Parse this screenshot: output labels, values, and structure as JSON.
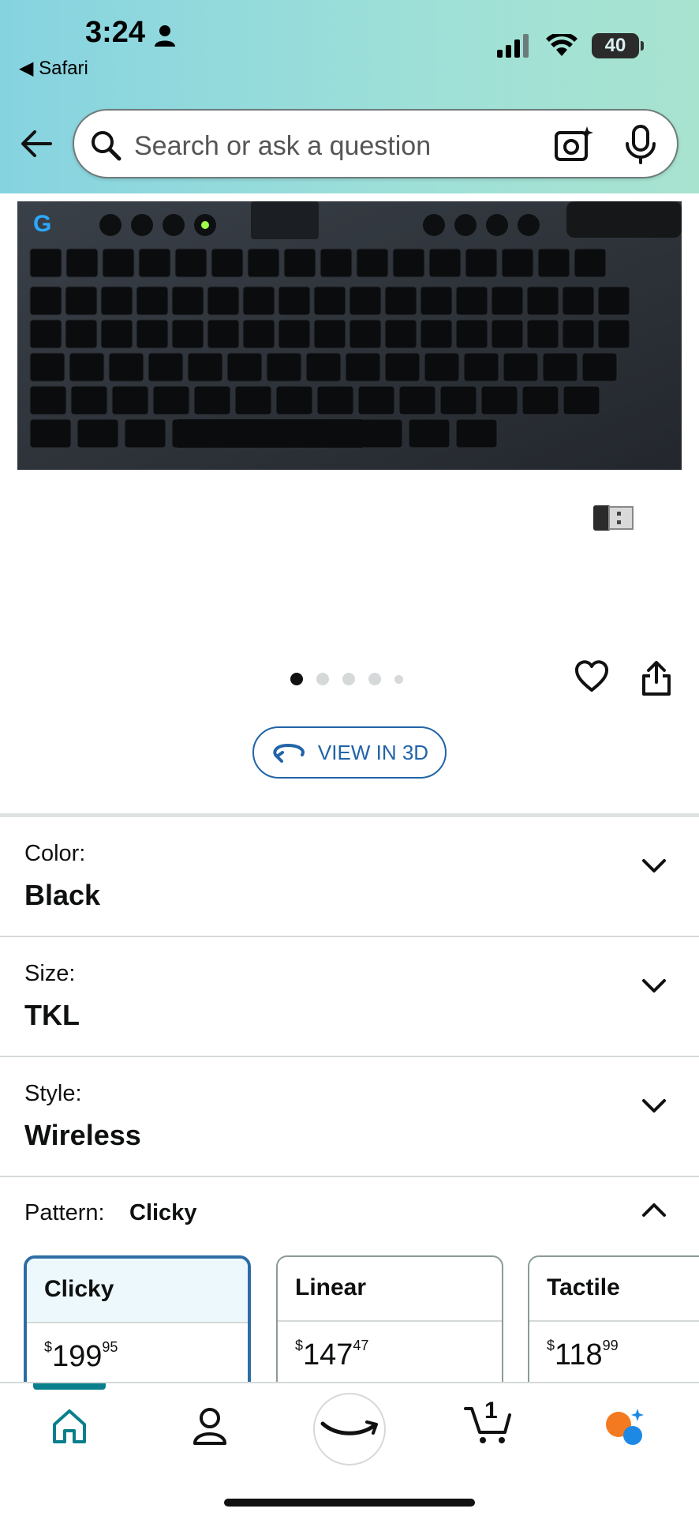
{
  "status_bar": {
    "time": "3:24",
    "back_app": "Safari",
    "battery": "40"
  },
  "search": {
    "placeholder": "Search or ask a question"
  },
  "carousel": {
    "count": 5,
    "active_index": 0
  },
  "view3d": {
    "label": "VIEW IN 3D"
  },
  "options": [
    {
      "label": "Color:",
      "value": "Black"
    },
    {
      "label": "Size:",
      "value": "TKL"
    },
    {
      "label": "Style:",
      "value": "Wireless"
    }
  ],
  "pattern": {
    "label": "Pattern:",
    "value": "Clicky"
  },
  "pattern_cards": [
    {
      "name": "Clicky",
      "currency": "$",
      "price_whole": "199",
      "price_fraction": "95",
      "selected": true
    },
    {
      "name": "Linear",
      "currency": "$",
      "price_whole": "147",
      "price_fraction": "47",
      "selected": false
    },
    {
      "name": "Tactile",
      "currency": "$",
      "price_whole": "118",
      "price_fraction": "99",
      "selected": false
    }
  ],
  "cart": {
    "count": "1"
  },
  "colors": {
    "accent_blue": "#2164a8",
    "selected_border": "#2e6da4",
    "nav_active": "#0a7f8c",
    "rufus_orange": "#f47a21",
    "rufus_blue": "#1e88e5"
  }
}
